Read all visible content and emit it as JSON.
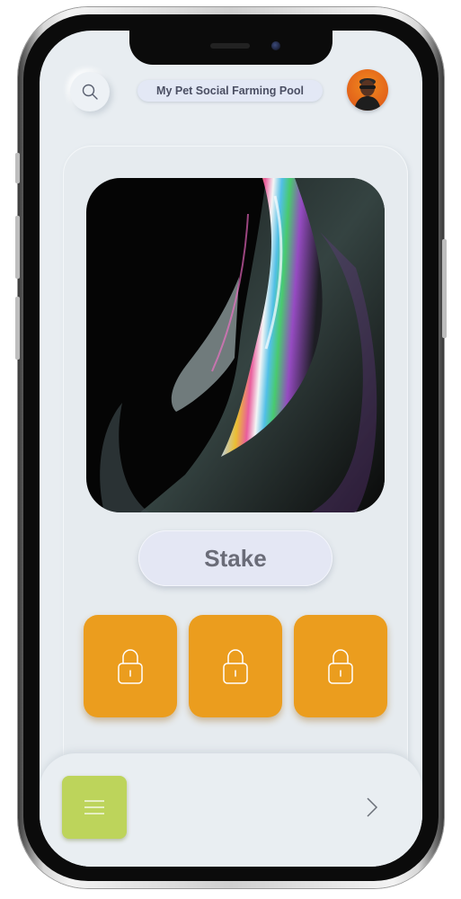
{
  "header": {
    "title": "My Pet Social Farming Pool",
    "search_icon": "search-icon",
    "avatar_icon": "user-avatar"
  },
  "main": {
    "stake_label": "Stake",
    "lock_tiles": [
      {
        "icon": "lock-icon",
        "state": "locked"
      },
      {
        "icon": "lock-icon",
        "state": "locked"
      },
      {
        "icon": "lock-icon",
        "state": "locked"
      }
    ]
  },
  "footer": {
    "menu_icon": "menu-icon",
    "next_icon": "chevron-right-icon"
  },
  "colors": {
    "screen_bg": "#e8edf1",
    "lock_tile": "#eb9d1e",
    "menu_button": "#bdd45b",
    "title_text": "#4b4f63",
    "stake_text": "#6a6c78"
  }
}
